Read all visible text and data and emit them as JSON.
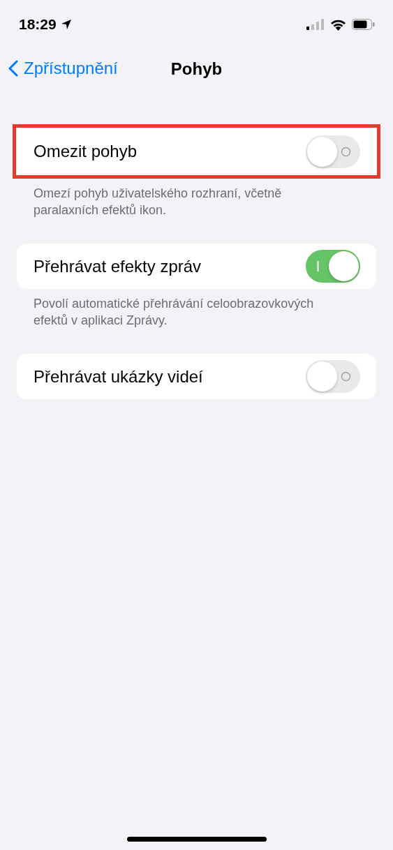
{
  "status_bar": {
    "time": "18:29"
  },
  "nav": {
    "back_label": "Zpřístupnění",
    "title": "Pohyb"
  },
  "settings": [
    {
      "label": "Omezit pohyb",
      "on": false,
      "highlighted": true,
      "footnote": "Omezí pohyb uživatelského rozhraní, včetně paralaxních efektů ikon."
    },
    {
      "label": "Přehrávat efekty zpráv",
      "on": true,
      "highlighted": false,
      "footnote": "Povolí automatické přehrávání celoobrazovkových efektů v aplikaci Zprávy."
    },
    {
      "label": "Přehrávat ukázky videí",
      "on": false,
      "highlighted": false
    }
  ]
}
